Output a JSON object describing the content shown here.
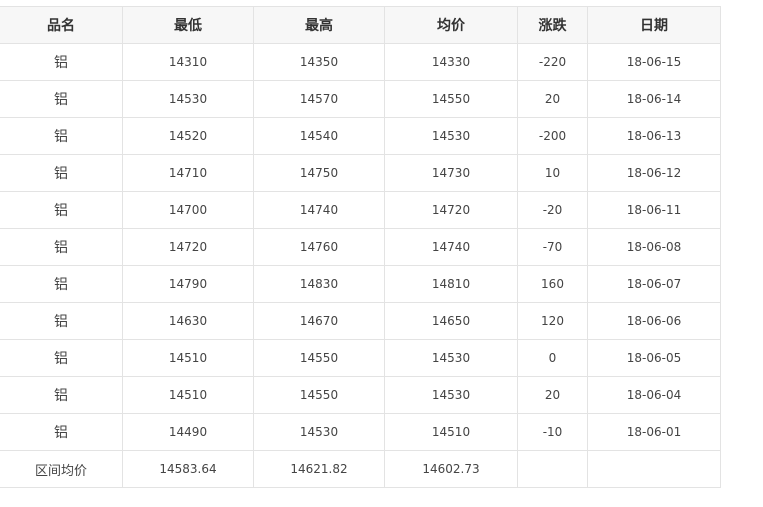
{
  "table": {
    "headers": [
      "品名",
      "最低",
      "最高",
      "均价",
      "涨跌",
      "日期"
    ],
    "rows": [
      [
        "铝",
        "14310",
        "14350",
        "14330",
        "-220",
        "18-06-15"
      ],
      [
        "铝",
        "14530",
        "14570",
        "14550",
        "20",
        "18-06-14"
      ],
      [
        "铝",
        "14520",
        "14540",
        "14530",
        "-200",
        "18-06-13"
      ],
      [
        "铝",
        "14710",
        "14750",
        "14730",
        "10",
        "18-06-12"
      ],
      [
        "铝",
        "14700",
        "14740",
        "14720",
        "-20",
        "18-06-11"
      ],
      [
        "铝",
        "14720",
        "14760",
        "14740",
        "-70",
        "18-06-08"
      ],
      [
        "铝",
        "14790",
        "14830",
        "14810",
        "160",
        "18-06-07"
      ],
      [
        "铝",
        "14630",
        "14670",
        "14650",
        "120",
        "18-06-06"
      ],
      [
        "铝",
        "14510",
        "14550",
        "14530",
        "0",
        "18-06-05"
      ],
      [
        "铝",
        "14510",
        "14550",
        "14530",
        "20",
        "18-06-04"
      ],
      [
        "铝",
        "14490",
        "14530",
        "14510",
        "-10",
        "18-06-01"
      ]
    ],
    "footer": {
      "label": "区间均价",
      "avg_low": "14583.64",
      "avg_high": "14621.82",
      "avg_mean": "14602.73",
      "change": "",
      "date": ""
    }
  }
}
